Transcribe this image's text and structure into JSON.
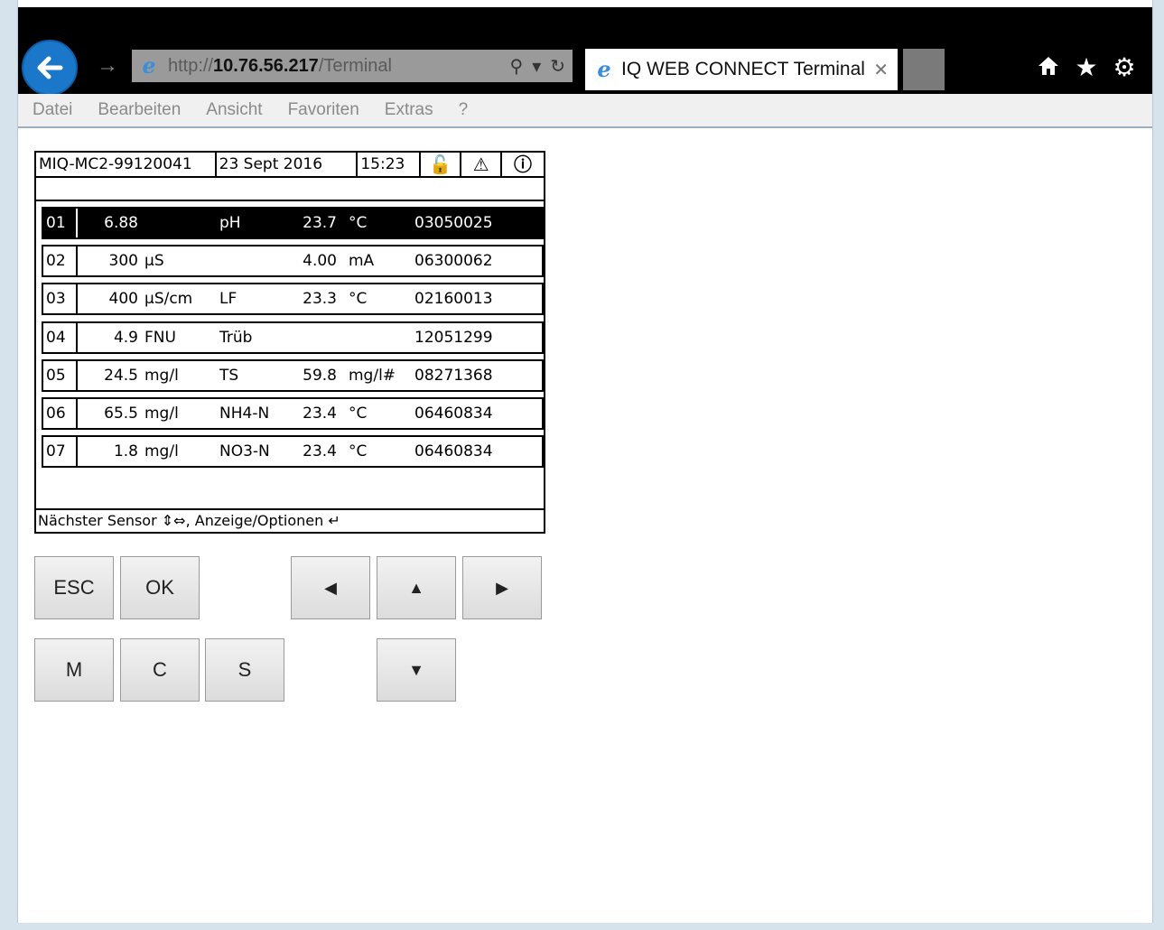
{
  "browser": {
    "url_prefix": "http://",
    "url_host": "10.76.56.217",
    "url_path": "/Terminal",
    "tab_title": "IQ WEB CONNECT Terminal",
    "tab_close": "✕",
    "back_icon": "back-arrow-icon",
    "forward_icon": "forward-arrow-icon",
    "search_icon": "⚲",
    "dropdown_icon": "▾",
    "refresh_icon": "↻",
    "home_icon": "🏠",
    "favorites_icon": "★",
    "settings_icon": "⚙",
    "accent": "#1b77c9"
  },
  "menu": {
    "items": [
      "Datei",
      "Bearbeiten",
      "Ansicht",
      "Favoriten",
      "Extras",
      "?"
    ]
  },
  "terminal": {
    "device": "MIQ-MC2-99120041",
    "date": "23 Sept 2016",
    "time": "15:23",
    "status_icons": [
      "🔓",
      "⚠",
      "ⓘ"
    ],
    "footer": "Nächster Sensor ⇕⇔, Anzeige/Optionen ↵",
    "selected_row": 0,
    "sensors": [
      {
        "num": "01",
        "value": "6.88",
        "unit": "",
        "param": "pH",
        "sec_value": "23.7",
        "sec_unit": "°C",
        "serial": "03050025"
      },
      {
        "num": "02",
        "value": "300",
        "unit": "µS",
        "param": "",
        "sec_value": "4.00",
        "sec_unit": "mA",
        "serial": "06300062"
      },
      {
        "num": "03",
        "value": "400",
        "unit": "µS/cm",
        "param": "LF",
        "sec_value": "23.3",
        "sec_unit": "°C",
        "serial": "02160013"
      },
      {
        "num": "04",
        "value": "4.9",
        "unit": "FNU",
        "param": "Trüb",
        "sec_value": "",
        "sec_unit": "",
        "serial": "12051299"
      },
      {
        "num": "05",
        "value": "24.5",
        "unit": "mg/l",
        "param": "TS",
        "sec_value": "59.8",
        "sec_unit": "mg/l#",
        "serial": "08271368"
      },
      {
        "num": "06",
        "value": "65.5",
        "unit": "mg/l",
        "param": "NH4-N",
        "sec_value": "23.4",
        "sec_unit": "°C",
        "serial": "06460834"
      },
      {
        "num": "07",
        "value": "1.8",
        "unit": "mg/l",
        "param": "NO3-N",
        "sec_value": "23.4",
        "sec_unit": "°C",
        "serial": "06460834"
      }
    ]
  },
  "keypad": {
    "esc": "ESC",
    "ok": "OK",
    "left": "◀",
    "up": "▲",
    "right": "▶",
    "m": "M",
    "c": "C",
    "s": "S",
    "down": "▼"
  }
}
